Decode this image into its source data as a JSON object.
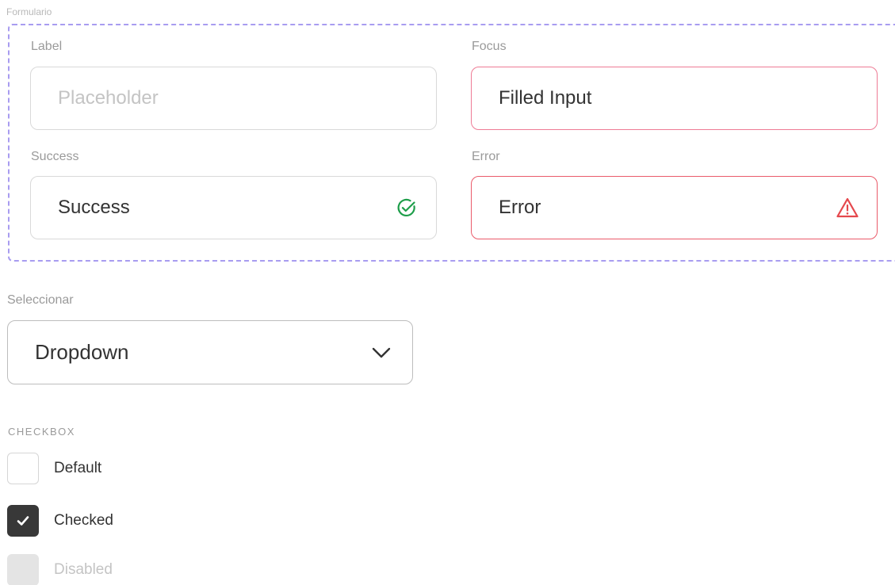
{
  "frame": {
    "label": "Formulario"
  },
  "fields": {
    "label_field": {
      "label": "Label",
      "placeholder": "Placeholder",
      "value": ""
    },
    "focus_field": {
      "label": "Focus",
      "value": "Filled Input",
      "border_color": "#ee7b95"
    },
    "success_field": {
      "label": "Success",
      "value": "Success",
      "icon": "check-circle-icon",
      "icon_color": "#1e9e4a"
    },
    "error_field": {
      "label": "Error",
      "value": "Error",
      "icon": "warning-triangle-icon",
      "icon_color": "#e5484d"
    }
  },
  "select": {
    "label": "Seleccionar",
    "value": "Dropdown",
    "icon": "chevron-down-icon"
  },
  "checkbox_section": {
    "heading": "CHECKBOX",
    "items": [
      {
        "label": "Default",
        "state": "unchecked"
      },
      {
        "label": "Checked",
        "state": "checked",
        "icon": "checkmark-icon"
      },
      {
        "label": "Disabled",
        "state": "disabled"
      }
    ]
  },
  "colors": {
    "frame_dash": "#a89cf0",
    "checked_fill": "#383838",
    "disabled_fill": "#e4e4e4"
  }
}
